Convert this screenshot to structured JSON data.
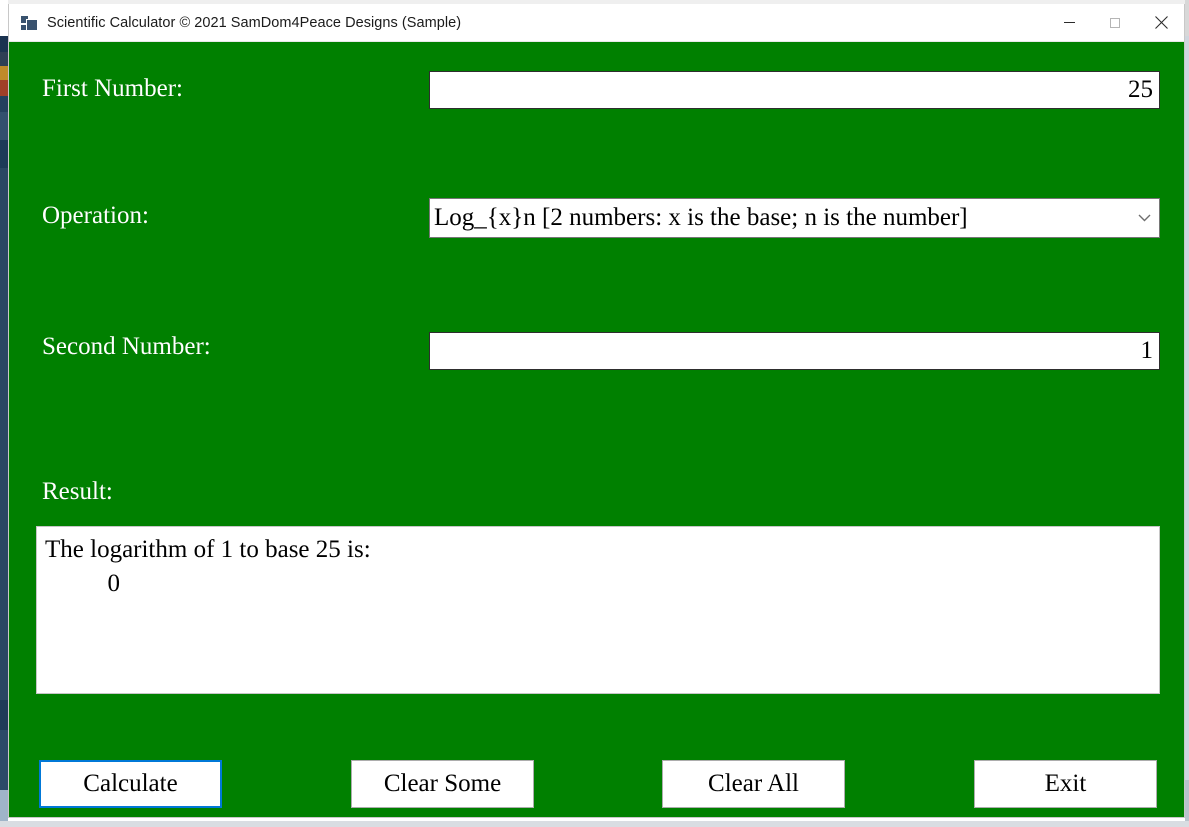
{
  "window": {
    "title": "Scientific Calculator © 2021 SamDom4Peace Designs (Sample)",
    "icon": "windows-forms-icon",
    "background_color": "#008000",
    "controls": {
      "minimize": "minimize-icon",
      "maximize": "maximize-icon",
      "close": "close-icon"
    }
  },
  "form": {
    "first_number": {
      "label": "First Number:",
      "value": "25",
      "placeholder": ""
    },
    "operation": {
      "label": "Operation:",
      "selected": "Log_{x}n [2 numbers: x is the base; n is the number]",
      "arrow_icon": "chevron-down-icon"
    },
    "second_number": {
      "label": "Second Number:",
      "value": "1",
      "placeholder": ""
    },
    "result": {
      "label": "Result:",
      "line1": "The logarithm of 1 to base 25 is:",
      "line2": "",
      "line3": "          0"
    }
  },
  "buttons": {
    "calculate": "Calculate",
    "clear_some": "Clear Some",
    "clear_all": "Clear All",
    "exit": "Exit",
    "focus_accent_color": "#0078d7"
  }
}
